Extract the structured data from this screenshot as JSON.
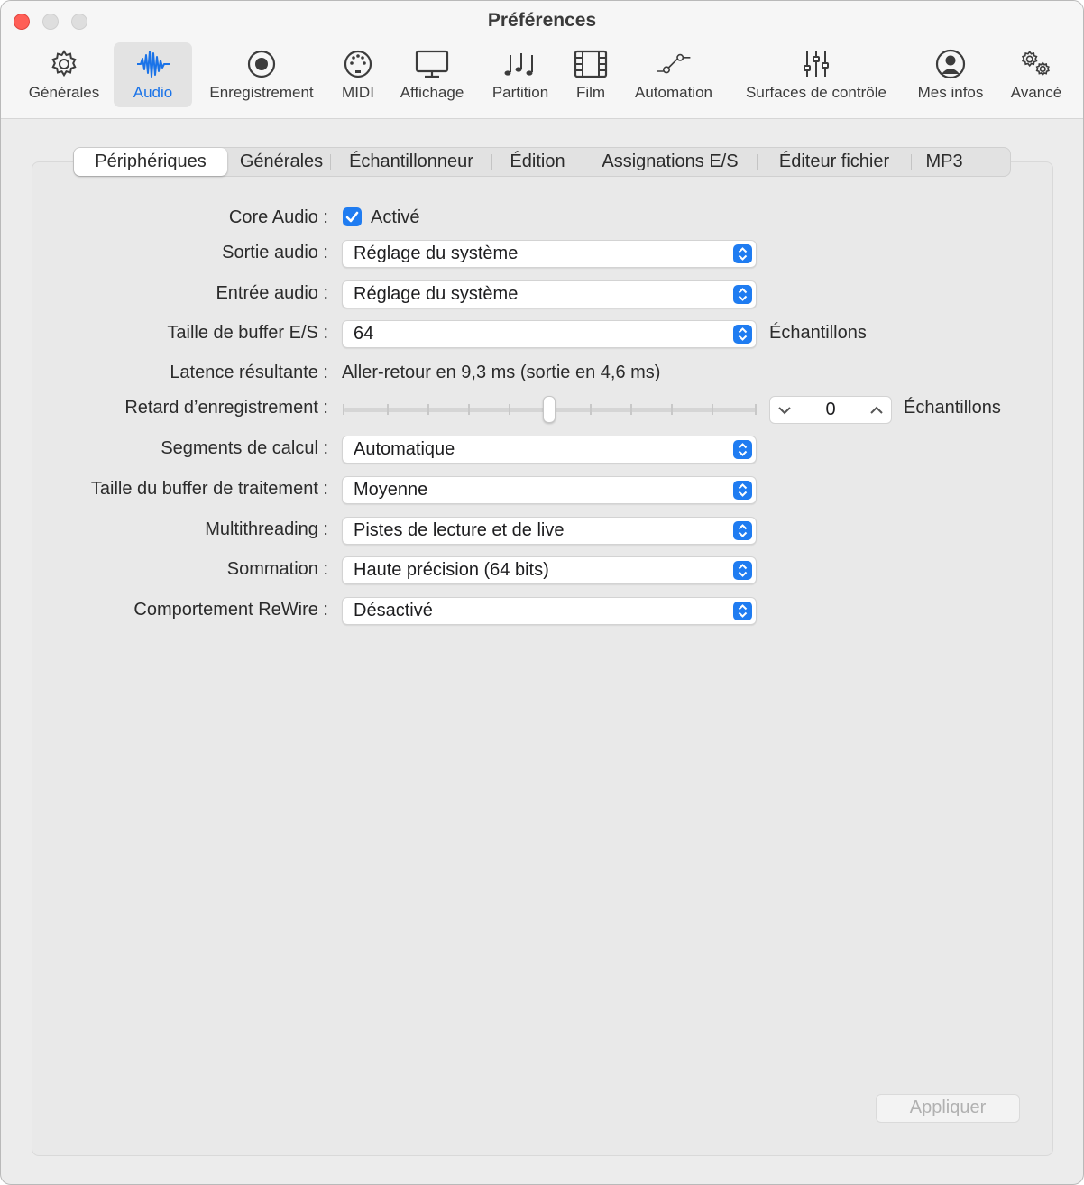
{
  "window": {
    "title": "Préférences"
  },
  "toolbar": {
    "items": [
      {
        "label": "Générales",
        "icon": "gear-icon"
      },
      {
        "label": "Audio",
        "icon": "waveform-icon",
        "selected": true
      },
      {
        "label": "Enregistrement",
        "icon": "record-icon"
      },
      {
        "label": "MIDI",
        "icon": "midi-port-icon"
      },
      {
        "label": "Affichage",
        "icon": "monitor-icon"
      },
      {
        "label": "Partition",
        "icon": "music-notes-icon"
      },
      {
        "label": "Film",
        "icon": "film-icon"
      },
      {
        "label": "Automation",
        "icon": "automation-curve-icon"
      },
      {
        "label": "Surfaces de contrôle",
        "icon": "faders-icon"
      },
      {
        "label": "Mes infos",
        "icon": "user-icon"
      },
      {
        "label": "Avancé",
        "icon": "gears-icon"
      }
    ],
    "accent_color": "#1a73e8"
  },
  "tabs": [
    {
      "label": "Périphériques",
      "active": true
    },
    {
      "label": "Générales"
    },
    {
      "label": "Échantillonneur"
    },
    {
      "label": "Édition"
    },
    {
      "label": "Assignations E/S"
    },
    {
      "label": "Éditeur fichier"
    },
    {
      "label": "MP3"
    }
  ],
  "settings": {
    "core_audio": {
      "label": "Core Audio :",
      "checkbox_label": "Activé",
      "checked": true
    },
    "audio_output": {
      "label": "Sortie audio :",
      "value": "Réglage du système"
    },
    "audio_input": {
      "label": "Entrée audio :",
      "value": "Réglage du système"
    },
    "io_buffer": {
      "label": "Taille de buffer E/S :",
      "value": "64",
      "unit": "Échantillons"
    },
    "latency": {
      "label": "Latence résultante :",
      "value": "Aller-retour en 9,3 ms (sortie en 4,6 ms)"
    },
    "record_delay": {
      "label": "Retard d’enregistrement :",
      "value": "0",
      "unit": "Échantillons",
      "slider_position": 0.5
    },
    "process_threads": {
      "label": "Segments de calcul :",
      "value": "Automatique"
    },
    "process_buffer": {
      "label": "Taille du buffer de traitement :",
      "value": "Moyenne"
    },
    "multithreading": {
      "label": "Multithreading :",
      "value": "Pistes de lecture et de live"
    },
    "summing": {
      "label": "Sommation :",
      "value": "Haute précision (64 bits)"
    },
    "rewire": {
      "label": "Comportement ReWire :",
      "value": "Désactivé"
    }
  },
  "footer": {
    "apply_label": "Appliquer",
    "apply_enabled": false
  },
  "colors": {
    "popup_button": "#1f7cf1",
    "close": "#ff5f57"
  }
}
